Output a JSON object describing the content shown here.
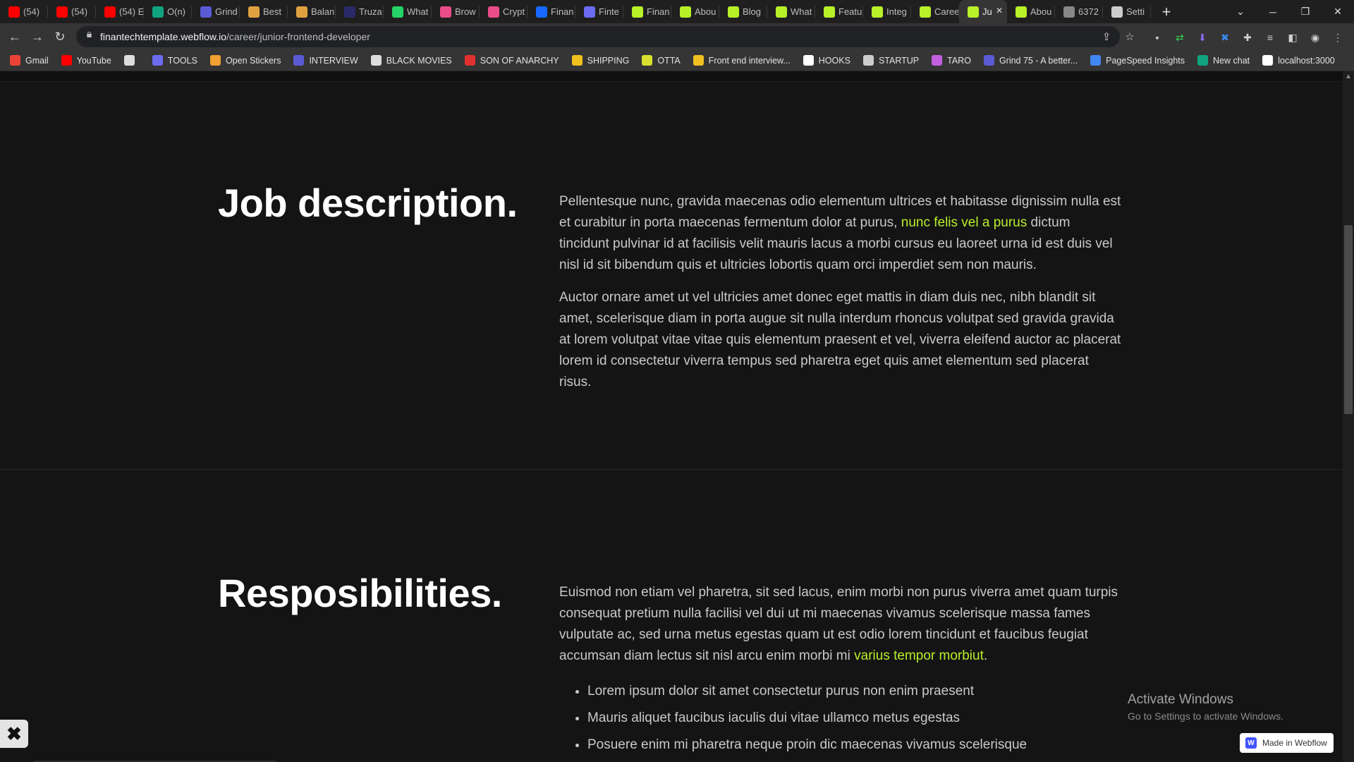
{
  "browser": {
    "tabs": [
      {
        "title": "(54)",
        "icon": "youtube-icon",
        "color": "#ff0000"
      },
      {
        "title": "(54)",
        "icon": "youtube-icon",
        "color": "#ff0000"
      },
      {
        "title": "(54) E",
        "icon": "youtube-icon",
        "color": "#ff0000"
      },
      {
        "title": "O(n)",
        "icon": "chatgpt-icon",
        "color": "#10a37f"
      },
      {
        "title": "Grind",
        "icon": "grind75-icon",
        "color": "#5b5bd6"
      },
      {
        "title": "Best",
        "icon": "article-icon",
        "color": "#e0a040"
      },
      {
        "title": "Balan",
        "icon": "article-icon",
        "color": "#e0a040"
      },
      {
        "title": "Truza",
        "icon": "circle-icon",
        "color": "#2a2a6a"
      },
      {
        "title": "What",
        "icon": "whatsapp-icon",
        "color": "#25d366"
      },
      {
        "title": "Brow",
        "icon": "dribbble-icon",
        "color": "#ea4c89"
      },
      {
        "title": "Crypt",
        "icon": "dribbble-icon",
        "color": "#ea4c89"
      },
      {
        "title": "Finan",
        "icon": "behance-icon",
        "color": "#1769ff"
      },
      {
        "title": "Finte",
        "icon": "dots-icon",
        "color": "#6c6cf0"
      },
      {
        "title": "Finan",
        "icon": "finantech-icon",
        "color": "#b8f02a"
      },
      {
        "title": "Abou",
        "icon": "finantech-icon",
        "color": "#b8f02a"
      },
      {
        "title": "Blog",
        "icon": "finantech-icon",
        "color": "#b8f02a"
      },
      {
        "title": "What",
        "icon": "finantech-icon",
        "color": "#b8f02a"
      },
      {
        "title": "Featu",
        "icon": "finantech-icon",
        "color": "#b8f02a"
      },
      {
        "title": "Integ",
        "icon": "finantech-icon",
        "color": "#b8f02a"
      },
      {
        "title": "Caree",
        "icon": "finantech-icon",
        "color": "#b8f02a"
      },
      {
        "title": "Ju",
        "icon": "finantech-icon",
        "color": "#b8f02a",
        "active": true
      },
      {
        "title": "Abou",
        "icon": "finantech-icon",
        "color": "#b8f02a"
      },
      {
        "title": "6372",
        "icon": "globe-icon",
        "color": "#888888"
      },
      {
        "title": "Setti",
        "icon": "gear-icon",
        "color": "#cccccc"
      }
    ],
    "url_host": "finantechtemplate.webflow.io",
    "url_path": "/career/junior-frontend-developer",
    "bookmarks": [
      {
        "label": "Gmail",
        "icon": "gmail-icon",
        "color": "#ea4335"
      },
      {
        "label": "YouTube",
        "icon": "youtube-icon",
        "color": "#ff0000"
      },
      {
        "label": "",
        "icon": "globe-icon",
        "color": "#dddddd"
      },
      {
        "label": "TOOLS",
        "icon": "tools-icon",
        "color": "#6c6cf0"
      },
      {
        "label": "Open Stickers",
        "icon": "sticker-icon",
        "color": "#f0a030"
      },
      {
        "label": "INTERVIEW",
        "icon": "interview-icon",
        "color": "#5b5bd6"
      },
      {
        "label": "BLACK MOVIES",
        "icon": "globe-icon",
        "color": "#dddddd"
      },
      {
        "label": "SON OF ANARCHY",
        "icon": "folder-icon",
        "color": "#e03030"
      },
      {
        "label": "SHIPPING",
        "icon": "chevron-icon",
        "color": "#f0c020"
      },
      {
        "label": "OTTA",
        "icon": "otta-icon",
        "color": "#d8e030"
      },
      {
        "label": "Front end interview...",
        "icon": "bookmark-icon",
        "color": "#f0c020"
      },
      {
        "label": "HOOKS",
        "icon": "hooks-icon",
        "color": "#ffffff"
      },
      {
        "label": "STARTUP",
        "icon": "list-icon",
        "color": "#cccccc"
      },
      {
        "label": "TARO",
        "icon": "taro-icon",
        "color": "#c060e0"
      },
      {
        "label": "Grind 75 - A better...",
        "icon": "grind75-icon",
        "color": "#5b5bd6"
      },
      {
        "label": "PageSpeed Insights",
        "icon": "pagespeed-icon",
        "color": "#4285f4"
      },
      {
        "label": "New chat",
        "icon": "chatgpt-icon",
        "color": "#10a37f"
      },
      {
        "label": "localhost:3000",
        "icon": "triangle-icon",
        "color": "#ffffff"
      }
    ]
  },
  "sections": {
    "job": {
      "title": "Job description.",
      "p1_a": "Pellentesque nunc, gravida maecenas odio elementum ultrices et habitasse dignissim nulla est et curabitur in porta maecenas fermentum dolor at purus, ",
      "p1_link": "nunc felis vel a purus",
      "p1_b": " dictum tincidunt pulvinar id at facilisis velit mauris lacus a morbi cursus eu laoreet urna id est duis vel nisl id sit bibendum quis et ultricies lobortis quam orci imperdiet sem non mauris.",
      "p2": "Auctor ornare amet ut vel ultricies amet donec eget mattis in diam duis nec, nibh blandit sit amet, scelerisque diam in porta augue sit nulla interdum rhoncus volutpat sed gravida gravida at  lorem volutpat vitae vitae quis elementum praesent et vel, viverra eleifend auctor ac placerat  lorem id consectetur viverra tempus sed pharetra eget quis amet elementum sed placerat risus."
    },
    "resp": {
      "title": "Resposibilities.",
      "p1_a": "Euismod non etiam vel pharetra, sit sed lacus, enim morbi non purus viverra amet quam turpis consequat pretium nulla facilisi vel dui ut mi maecenas vivamus scelerisque massa fames vulputate ac, sed urna metus egestas quam ut est odio lorem tincidunt et faucibus feugiat accumsan diam lectus sit nisl arcu enim morbi mi ",
      "p1_link": "varius  tempor morbiut",
      "p1_b": ".",
      "bullets": [
        "Lorem ipsum dolor sit amet consectetur purus non enim praesent",
        "Mauris aliquet faucibus iaculis dui vitae ullamco metus egestas",
        "Posuere enim mi pharetra neque proin dic maecenas vivamus scelerisque"
      ]
    }
  },
  "overlay": {
    "activate_title": "Activate Windows",
    "activate_sub": "Go to Settings to activate Windows.",
    "webflow_badge": "Made in Webflow"
  }
}
